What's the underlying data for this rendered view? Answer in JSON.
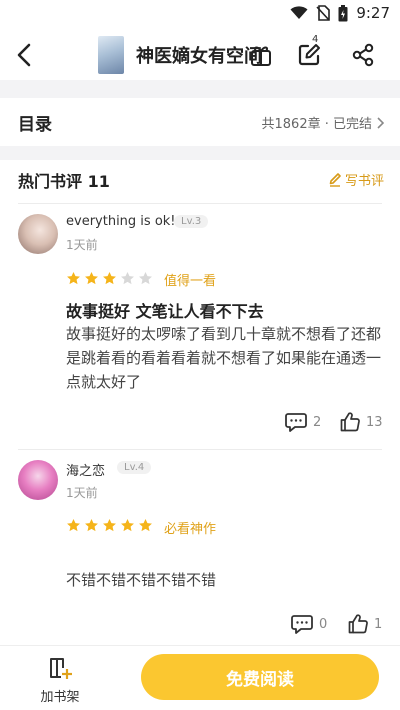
{
  "status_bar": {
    "time": "9:27"
  },
  "header": {
    "book_title": "神医嫡女有空间",
    "edit_badge": "4"
  },
  "toc": {
    "title": "目录",
    "meta": "共1862章 · 已完结"
  },
  "reviews_section": {
    "title": "热门书评 11",
    "write_label": "写书评",
    "reviews": [
      {
        "username": "everything is ok!",
        "level": "Lv.3",
        "time": "1天前",
        "rating": 3,
        "rating_label": "值得一看",
        "headline": "故事挺好 文笔让人看不下去",
        "body": "故事挺好的太啰嗦了看到几十章就不想看了还都是跳着看的看着看着就不想看了如果能在通透一点就太好了",
        "comments": "2",
        "likes": "13"
      },
      {
        "username": "海之恋",
        "level": "Lv.4",
        "time": "1天前",
        "rating": 5,
        "rating_label": "必看神作",
        "headline": "",
        "body": "不错不错不错不错不错",
        "comments": "0",
        "likes": "1"
      }
    ]
  },
  "bottom_bar": {
    "shelf_label": "加书架",
    "read_label": "免费阅读"
  },
  "colors": {
    "accent": "#fbc730",
    "star": "#f5b41a",
    "star_empty": "#d8d8d8",
    "link": "#d79a18"
  }
}
